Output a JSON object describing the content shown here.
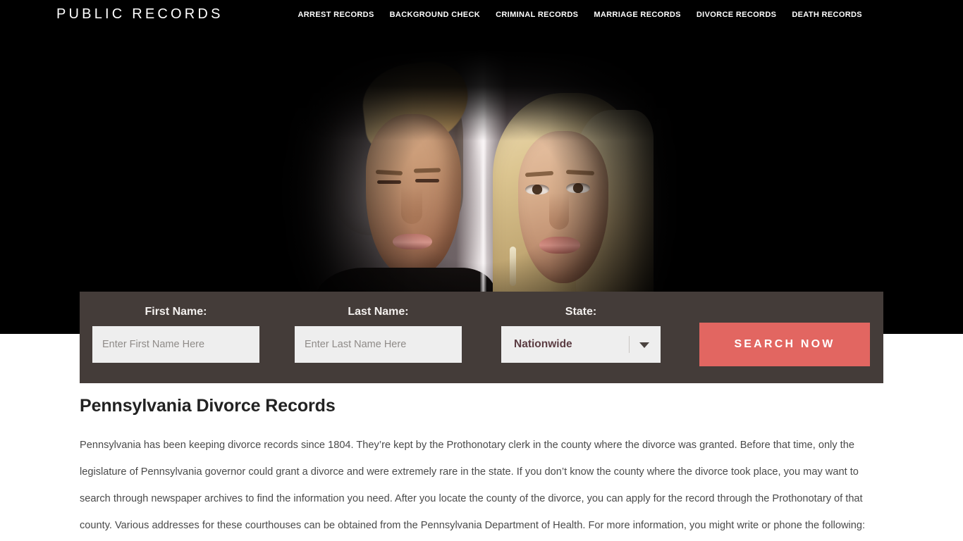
{
  "header": {
    "logo": "PUBLIC RECORDS",
    "nav": [
      {
        "label": "ARREST RECORDS"
      },
      {
        "label": "BACKGROUND CHECK"
      },
      {
        "label": "CRIMINAL RECORDS"
      },
      {
        "label": "MARRIAGE RECORDS"
      },
      {
        "label": "DIVORCE RECORDS"
      },
      {
        "label": "DEATH RECORDS"
      }
    ]
  },
  "hero": {
    "image_alt": "couple separated by a wall looking away from each other",
    "background_color": "#000000"
  },
  "search": {
    "bar_color": "#443c39",
    "first_name": {
      "label": "First Name:",
      "placeholder": "Enter First Name Here",
      "value": ""
    },
    "last_name": {
      "label": "Last Name:",
      "placeholder": "Enter Last Name Here",
      "value": ""
    },
    "state": {
      "label": "State:",
      "selected": "Nationwide"
    },
    "submit": {
      "label": "SEARCH NOW",
      "color": "#e26661"
    }
  },
  "article": {
    "title": "Pennsylvania Divorce Records",
    "body": "Pennsylvania has been keeping divorce records since 1804. They’re kept by the Prothonotary clerk in the county where the divorce was granted. Before that time, only the legislature of Pennsylvania governor could grant a divorce and were extremely rare in the state. If you don’t know the county where the divorce took place, you may want to search through newspaper archives to find the information you need. After you locate the county of the divorce, you can apply for the record through the Prothonotary of that county. Various addresses for these courthouses can be obtained from the Pennsylvania Department of Health. For more information, you might write or phone the following:"
  }
}
